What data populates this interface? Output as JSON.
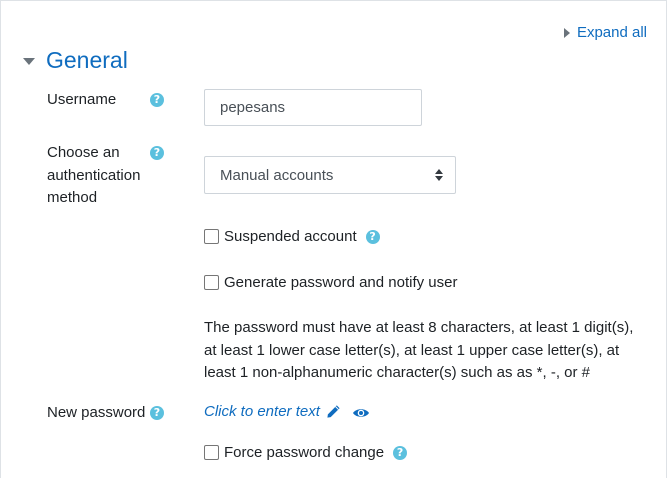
{
  "expand_all_label": "Expand all",
  "section": {
    "title": "General"
  },
  "username": {
    "label": "Username",
    "value": "pepesans"
  },
  "auth_method": {
    "label_lines": [
      "Choose an",
      "authentication",
      "method"
    ],
    "selected": "Manual accounts"
  },
  "suspended": {
    "label": "Suspended account"
  },
  "generate_password": {
    "label": "Generate password and notify user"
  },
  "password_policy": {
    "lines": [
      "The password must have at least 8 characters, at least 1 digit(s),",
      "at least 1 lower case letter(s), at least 1 upper case letter(s), at",
      "least 1 non-alphanumeric character(s) such as as *, -, or #"
    ]
  },
  "new_password": {
    "label": "New password",
    "link_text": "Click to enter text"
  },
  "force_change": {
    "label": "Force password change"
  },
  "colors": {
    "link": "#0f6cbf",
    "help": "#5bc0de",
    "text": "#1d2125"
  },
  "help_glyph": "?"
}
